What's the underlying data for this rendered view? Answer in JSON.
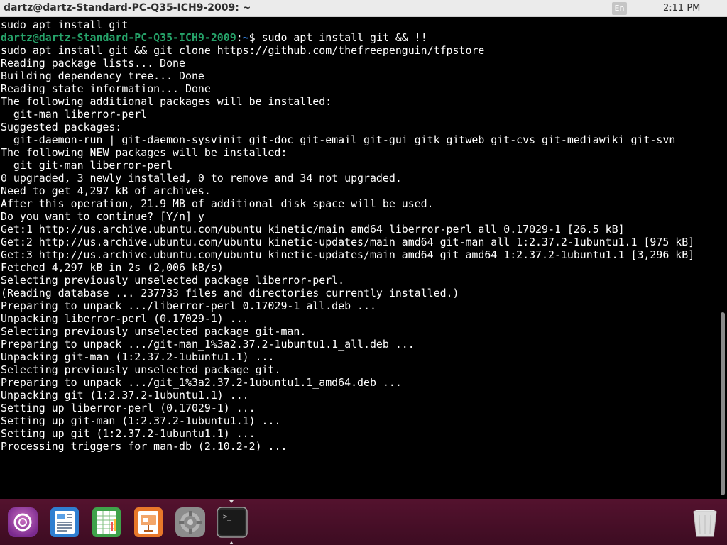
{
  "topbar": {
    "window_title": "dartz@dartz-Standard-PC-Q35-ICH9-2009: ~",
    "language": "En",
    "clock": "2:11 PM"
  },
  "terminal": {
    "prompt_user": "dartz@dartz-Standard-PC-Q35-ICH9-2009",
    "prompt_sep": ":",
    "prompt_path": "~",
    "prompt_symbol": "$ ",
    "prompt_command": "sudo apt install git && !!",
    "lines": [
      "sudo apt install git",
      "",
      "sudo apt install git && git clone https://github.com/thefreepenguin/tfpstore",
      "Reading package lists... Done",
      "Building dependency tree... Done",
      "Reading state information... Done",
      "The following additional packages will be installed:",
      "  git-man liberror-perl",
      "Suggested packages:",
      "  git-daemon-run | git-daemon-sysvinit git-doc git-email git-gui gitk gitweb git-cvs git-mediawiki git-svn",
      "The following NEW packages will be installed:",
      "  git git-man liberror-perl",
      "0 upgraded, 3 newly installed, 0 to remove and 34 not upgraded.",
      "Need to get 4,297 kB of archives.",
      "After this operation, 21.9 MB of additional disk space will be used.",
      "Do you want to continue? [Y/n] y",
      "Get:1 http://us.archive.ubuntu.com/ubuntu kinetic/main amd64 liberror-perl all 0.17029-1 [26.5 kB]",
      "Get:2 http://us.archive.ubuntu.com/ubuntu kinetic-updates/main amd64 git-man all 1:2.37.2-1ubuntu1.1 [975 kB]",
      "Get:3 http://us.archive.ubuntu.com/ubuntu kinetic-updates/main amd64 git amd64 1:2.37.2-1ubuntu1.1 [3,296 kB]",
      "Fetched 4,297 kB in 2s (2,006 kB/s)",
      "Selecting previously unselected package liberror-perl.",
      "(Reading database ... 237733 files and directories currently installed.)",
      "Preparing to unpack .../liberror-perl_0.17029-1_all.deb ...",
      "Unpacking liberror-perl (0.17029-1) ...",
      "Selecting previously unselected package git-man.",
      "Preparing to unpack .../git-man_1%3a2.37.2-1ubuntu1.1_all.deb ...",
      "Unpacking git-man (1:2.37.2-1ubuntu1.1) ...",
      "Selecting previously unselected package git.",
      "Preparing to unpack .../git_1%3a2.37.2-1ubuntu1.1_amd64.deb ...",
      "Unpacking git (1:2.37.2-1ubuntu1.1) ...",
      "Setting up liberror-perl (0.17029-1) ...",
      "Setting up git-man (1:2.37.2-1ubuntu1.1) ...",
      "Setting up git (1:2.37.2-1ubuntu1.1) ...",
      "Processing triggers for man-db (2.10.2-2) ..."
    ]
  },
  "dock": {
    "items": [
      {
        "icon": "app-center-icon"
      },
      {
        "icon": "writer-document-icon"
      },
      {
        "icon": "calc-spreadsheet-icon"
      },
      {
        "icon": "impress-presentation-icon"
      },
      {
        "icon": "settings-gear-icon"
      },
      {
        "icon": "terminal-icon"
      },
      {
        "icon": "trash-icon"
      }
    ]
  },
  "colors": {
    "prompt_user": "#26a269",
    "prompt_path": "#3584e4",
    "dock_bg": "#54122e",
    "terminal_bg": "#000000"
  }
}
